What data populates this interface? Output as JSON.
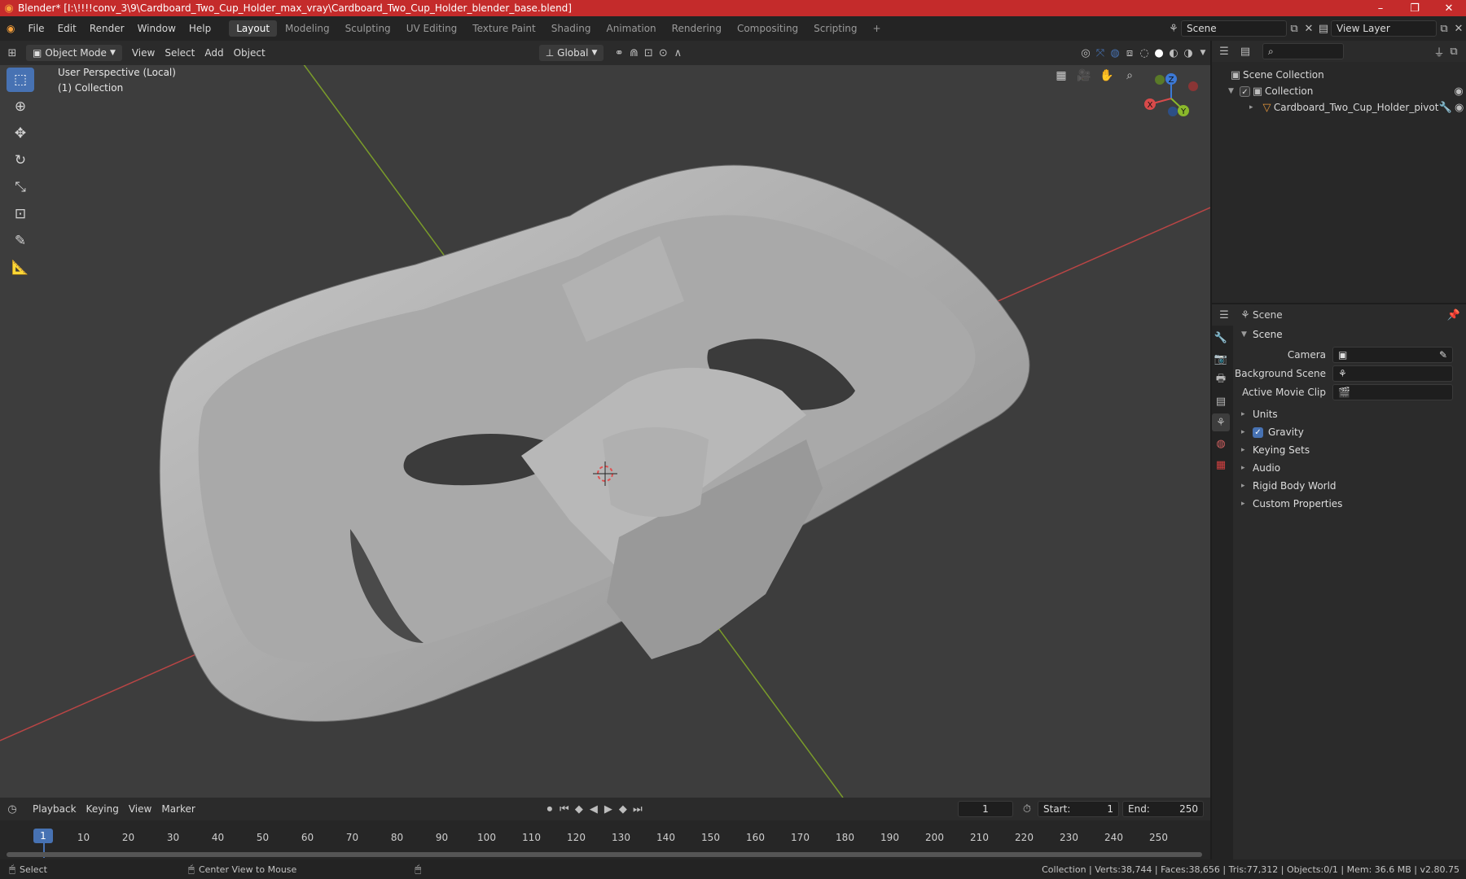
{
  "window": {
    "title": "Blender* [I:\\!!!!conv_3\\9\\Cardboard_Two_Cup_Holder_max_vray\\Cardboard_Two_Cup_Holder_blender_base.blend]",
    "minimize": "–",
    "restore": "❐",
    "close": "✕"
  },
  "menu": {
    "items": [
      "File",
      "Edit",
      "Render",
      "Window",
      "Help"
    ],
    "workspaces": [
      "Layout",
      "Modeling",
      "Sculpting",
      "UV Editing",
      "Texture Paint",
      "Shading",
      "Animation",
      "Rendering",
      "Compositing",
      "Scripting"
    ],
    "add_workspace": "+",
    "scene_value": "Scene",
    "view_layer_value": "View Layer"
  },
  "viewport_header": {
    "mode": "Object Mode",
    "menus": [
      "View",
      "Select",
      "Add",
      "Object"
    ],
    "orientation": "Global"
  },
  "viewport": {
    "perspective": "User Perspective (Local)",
    "collection": "(1) Collection",
    "gizmo": {
      "z": "Z",
      "y": "Y",
      "x": "X"
    }
  },
  "outliner": {
    "search_placeholder": "",
    "scene_collection": "Scene Collection",
    "collection": "Collection",
    "object": "Cardboard_Two_Cup_Holder_pivot"
  },
  "properties": {
    "context": "Scene",
    "panel_title": "Scene",
    "camera_label": "Camera",
    "background_scene_label": "Background Scene",
    "active_movie_clip_label": "Active Movie Clip",
    "subpanels": [
      "Units",
      "Gravity",
      "Keying Sets",
      "Audio",
      "Rigid Body World",
      "Custom Properties"
    ]
  },
  "timeline": {
    "menus": [
      "Playback",
      "Keying",
      "View",
      "Marker"
    ],
    "current_frame": "1",
    "start_label": "Start:",
    "start_value": "1",
    "end_label": "End:",
    "end_value": "250",
    "frame_marker": "1",
    "ticks": [
      "10",
      "20",
      "30",
      "40",
      "50",
      "60",
      "70",
      "80",
      "90",
      "100",
      "110",
      "120",
      "130",
      "140",
      "150",
      "160",
      "170",
      "180",
      "190",
      "200",
      "210",
      "220",
      "230",
      "240",
      "250"
    ]
  },
  "status": {
    "select": "Select",
    "center_view": "Center View to Mouse",
    "stats": "Collection | Verts:38,744 | Faces:38,656 | Tris:77,312 | Objects:0/1 | Mem: 36.6 MB | v2.80.75"
  },
  "colors": {
    "titlebar": "#c42b2b",
    "accent": "#4772b3",
    "viewport_bg": "#3d3d3d",
    "axis_x": "#d84a4a",
    "axis_y": "#8ab82b",
    "axis_z": "#3c79d6"
  }
}
